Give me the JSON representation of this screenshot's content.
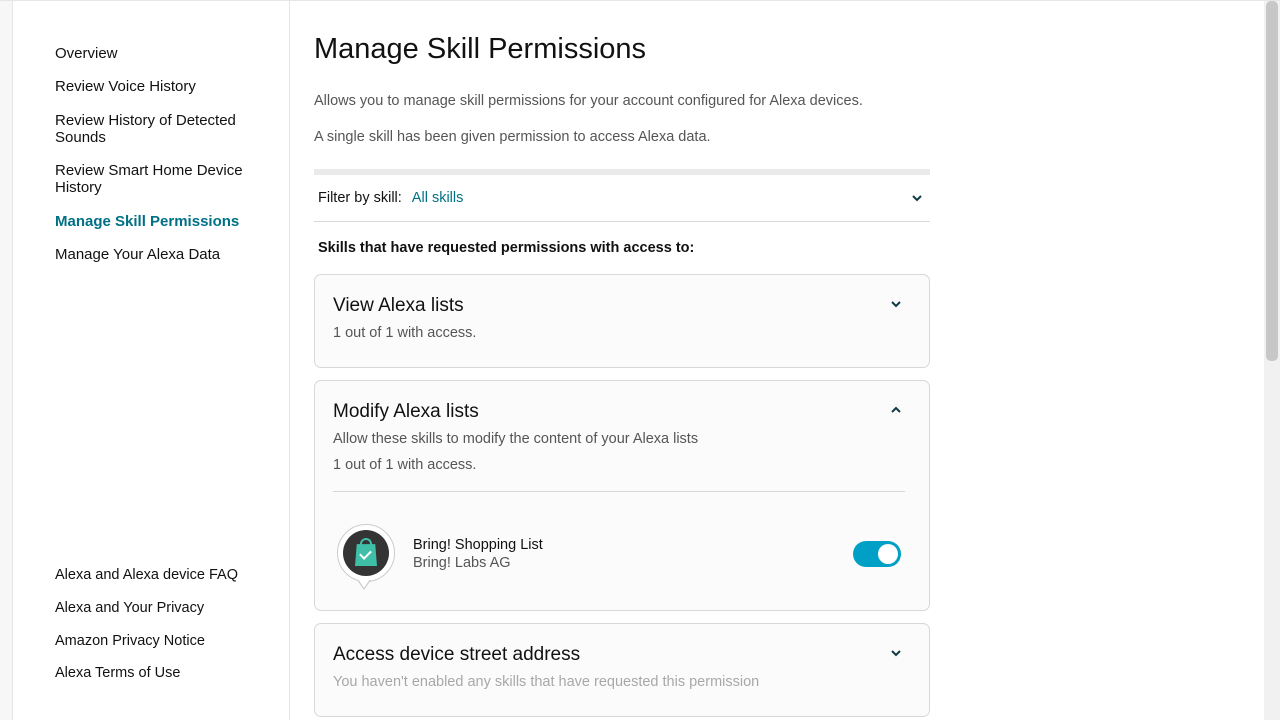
{
  "sidebar": {
    "nav": [
      {
        "label": "Overview",
        "active": false
      },
      {
        "label": "Review Voice History",
        "active": false
      },
      {
        "label": "Review History of Detected Sounds",
        "active": false
      },
      {
        "label": "Review Smart Home Device History",
        "active": false
      },
      {
        "label": "Manage Skill Permissions",
        "active": true
      },
      {
        "label": "Manage Your Alexa Data",
        "active": false
      }
    ],
    "footer": [
      {
        "label": "Alexa and Alexa device FAQ"
      },
      {
        "label": "Alexa and Your Privacy"
      },
      {
        "label": "Amazon Privacy Notice"
      },
      {
        "label": "Alexa Terms of Use"
      }
    ]
  },
  "main": {
    "title": "Manage Skill Permissions",
    "intro_a": "Allows you to manage skill permissions for your account configured for Alexa devices.",
    "intro_b": "A single skill has been given permission to access Alexa data.",
    "filter": {
      "label": "Filter by skill:",
      "value": "All skills"
    },
    "section_label": "Skills that have requested permissions with access to:",
    "cards": {
      "view_lists": {
        "title": "View Alexa lists",
        "count": "1 out of 1 with access."
      },
      "modify_lists": {
        "title": "Modify Alexa lists",
        "desc": "Allow these skills to modify the content of your Alexa lists",
        "count": "1 out of 1 with access.",
        "skill": {
          "name": "Bring! Shopping List",
          "dev": "Bring! Labs AG",
          "enabled": true
        }
      },
      "street_address": {
        "title": "Access device street address",
        "desc": "You haven't enabled any skills that have requested this permission"
      }
    }
  }
}
